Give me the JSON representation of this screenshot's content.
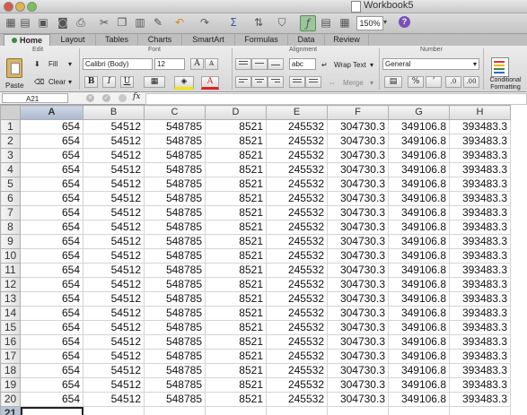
{
  "window": {
    "title": "Workbook5"
  },
  "toolbar": {
    "zoom": "150%",
    "help_label": "?",
    "icons": [
      "new-icon",
      "templates-icon",
      "open-icon",
      "save-icon",
      "print-icon",
      "cut-icon",
      "copy-icon",
      "paste-icon",
      "format-painter-icon",
      "undo-icon",
      "redo-icon",
      "autosum-icon",
      "sort-icon",
      "filter-icon",
      "formula-builder-icon",
      "media-icon",
      "toolbox-icon",
      "help-icon"
    ]
  },
  "ribbon": {
    "tabs": [
      {
        "label": "Home",
        "active": true
      },
      {
        "label": "Layout"
      },
      {
        "label": "Tables"
      },
      {
        "label": "Charts"
      },
      {
        "label": "SmartArt"
      },
      {
        "label": "Formulas"
      },
      {
        "label": "Data"
      },
      {
        "label": "Review"
      }
    ],
    "groups": {
      "edit": "Edit",
      "font": "Font",
      "alignment": "Alignment",
      "number": "Number"
    },
    "paste_label": "Paste",
    "fill_label": "Fill",
    "clear_label": "Clear",
    "font_name": "Calibri (Body)",
    "font_size": "12",
    "grow_font": "A",
    "shrink_font": "A",
    "bold": "B",
    "italic": "I",
    "underline": "U",
    "font_color_glyph": "A",
    "orientation_label": "abc",
    "wrap_text_label": "Wrap Text",
    "merge_label": "Merge",
    "number_format": "General",
    "percent_label": "%",
    "comma_label": "’",
    "conditional_formatting_label": "Conditional Formatting",
    "colors": {
      "fill": "#f4e400",
      "font": "#e02020"
    }
  },
  "formula_bar": {
    "cell_ref": "A21",
    "fx_label": "fx",
    "formula": ""
  },
  "grid": {
    "columns": [
      "A",
      "B",
      "C",
      "D",
      "E",
      "F",
      "G",
      "H"
    ],
    "selected_column": "A",
    "selected_row": 21,
    "rows": [
      {
        "n": "1",
        "cells": [
          "654",
          "54512",
          "548785",
          "8521",
          "245532",
          "304730.3",
          "349106.8",
          "393483.3"
        ]
      },
      {
        "n": "2",
        "cells": [
          "654",
          "54512",
          "548785",
          "8521",
          "245532",
          "304730.3",
          "349106.8",
          "393483.3"
        ]
      },
      {
        "n": "3",
        "cells": [
          "654",
          "54512",
          "548785",
          "8521",
          "245532",
          "304730.3",
          "349106.8",
          "393483.3"
        ]
      },
      {
        "n": "4",
        "cells": [
          "654",
          "54512",
          "548785",
          "8521",
          "245532",
          "304730.3",
          "349106.8",
          "393483.3"
        ]
      },
      {
        "n": "5",
        "cells": [
          "654",
          "54512",
          "548785",
          "8521",
          "245532",
          "304730.3",
          "349106.8",
          "393483.3"
        ]
      },
      {
        "n": "6",
        "cells": [
          "654",
          "54512",
          "548785",
          "8521",
          "245532",
          "304730.3",
          "349106.8",
          "393483.3"
        ]
      },
      {
        "n": "7",
        "cells": [
          "654",
          "54512",
          "548785",
          "8521",
          "245532",
          "304730.3",
          "349106.8",
          "393483.3"
        ]
      },
      {
        "n": "8",
        "cells": [
          "654",
          "54512",
          "548785",
          "8521",
          "245532",
          "304730.3",
          "349106.8",
          "393483.3"
        ]
      },
      {
        "n": "9",
        "cells": [
          "654",
          "54512",
          "548785",
          "8521",
          "245532",
          "304730.3",
          "349106.8",
          "393483.3"
        ]
      },
      {
        "n": "10",
        "cells": [
          "654",
          "54512",
          "548785",
          "8521",
          "245532",
          "304730.3",
          "349106.8",
          "393483.3"
        ]
      },
      {
        "n": "11",
        "cells": [
          "654",
          "54512",
          "548785",
          "8521",
          "245532",
          "304730.3",
          "349106.8",
          "393483.3"
        ]
      },
      {
        "n": "12",
        "cells": [
          "654",
          "54512",
          "548785",
          "8521",
          "245532",
          "304730.3",
          "349106.8",
          "393483.3"
        ]
      },
      {
        "n": "13",
        "cells": [
          "654",
          "54512",
          "548785",
          "8521",
          "245532",
          "304730.3",
          "349106.8",
          "393483.3"
        ]
      },
      {
        "n": "14",
        "cells": [
          "654",
          "54512",
          "548785",
          "8521",
          "245532",
          "304730.3",
          "349106.8",
          "393483.3"
        ]
      },
      {
        "n": "15",
        "cells": [
          "654",
          "54512",
          "548785",
          "8521",
          "245532",
          "304730.3",
          "349106.8",
          "393483.3"
        ]
      },
      {
        "n": "16",
        "cells": [
          "654",
          "54512",
          "548785",
          "8521",
          "245532",
          "304730.3",
          "349106.8",
          "393483.3"
        ]
      },
      {
        "n": "17",
        "cells": [
          "654",
          "54512",
          "548785",
          "8521",
          "245532",
          "304730.3",
          "349106.8",
          "393483.3"
        ]
      },
      {
        "n": "18",
        "cells": [
          "654",
          "54512",
          "548785",
          "8521",
          "245532",
          "304730.3",
          "349106.8",
          "393483.3"
        ]
      },
      {
        "n": "19",
        "cells": [
          "654",
          "54512",
          "548785",
          "8521",
          "245532",
          "304730.3",
          "349106.8",
          "393483.3"
        ]
      },
      {
        "n": "20",
        "cells": [
          "654",
          "54512",
          "548785",
          "8521",
          "245532",
          "304730.3",
          "349106.8",
          "393483.3"
        ]
      },
      {
        "n": "21",
        "cells": [
          "",
          "",
          "",
          "",
          "",
          "",
          "",
          ""
        ]
      }
    ]
  }
}
